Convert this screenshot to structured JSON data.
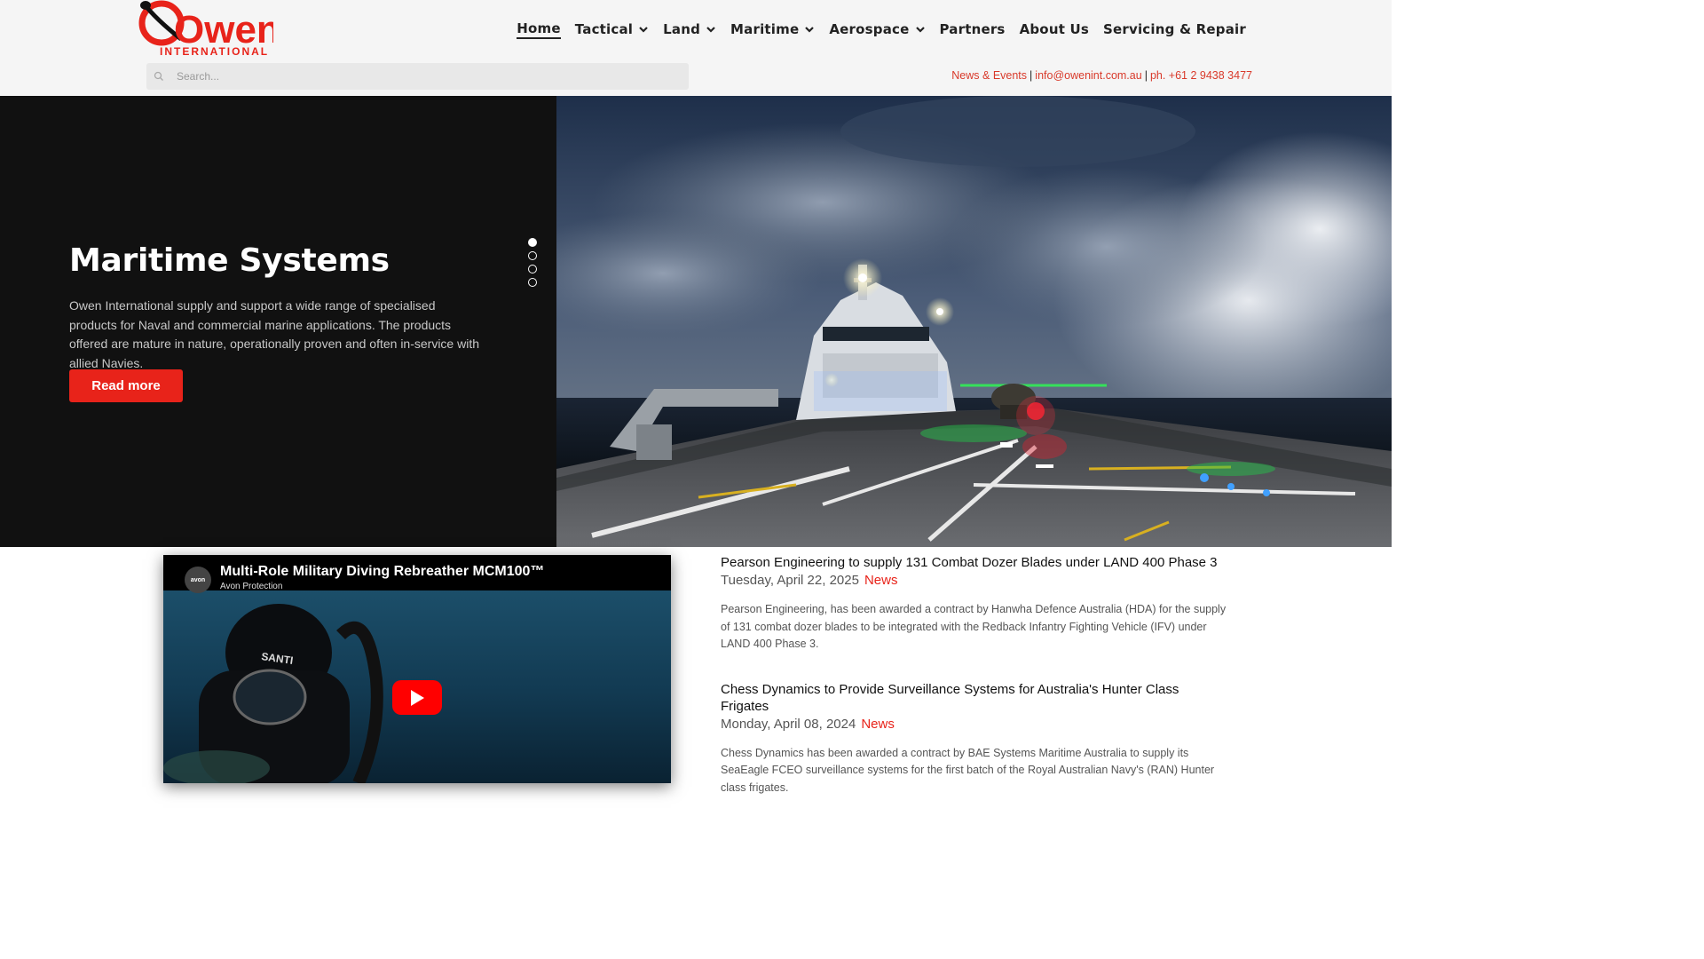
{
  "brand": {
    "logo_text": "Owen",
    "logo_subtext": "INTERNATIONAL",
    "brand_color": "#e8231a"
  },
  "nav": {
    "items": [
      {
        "label": "Home",
        "dropdown": false,
        "active": true
      },
      {
        "label": "Tactical",
        "dropdown": true
      },
      {
        "label": "Land",
        "dropdown": true
      },
      {
        "label": "Maritime",
        "dropdown": true
      },
      {
        "label": "Aerospace",
        "dropdown": true
      },
      {
        "label": "Partners",
        "dropdown": false
      },
      {
        "label": "About Us",
        "dropdown": false
      },
      {
        "label": "Servicing & Repair",
        "dropdown": false
      }
    ]
  },
  "search": {
    "placeholder": "Search...",
    "icon": "search-icon"
  },
  "contact": {
    "news_events": "News & Events",
    "email": "info@owenint.com.au",
    "phone": "ph. +61 2 9438 3477",
    "separator": "|"
  },
  "hero": {
    "title": "Maritime Systems",
    "description": "Owen International supply and support a wide range of specialised products for Naval and commercial marine applications. The products offered are mature in nature, operationally proven and often in-service with allied Navies.",
    "button_label": "Read more",
    "slides_count": 4,
    "active_slide": 1
  },
  "video": {
    "title": "Multi-Role Military Diving Rebreather MCM100™",
    "channel": "Avon Protection",
    "channel_logo_text": "avon"
  },
  "news": [
    {
      "title": "Pearson Engineering to supply 131 Combat Dozer Blades under LAND 400 Phase 3",
      "date": "Tuesday, April 22, 2025",
      "category": "News",
      "summary": "Pearson Engineering, has been awarded a contract by Hanwha Defence Australia (HDA) for the supply of 131 combat dozer blades to be integrated with the Redback Infantry Fighting Vehicle (IFV) under LAND 400 Phase 3."
    },
    {
      "title": "Chess Dynamics to Provide Surveillance Systems for Australia's Hunter Class Frigates",
      "date": "Monday, April 08, 2024",
      "category": "News",
      "summary": "Chess Dynamics has been awarded a contract by BAE Systems Maritime Australia to supply its SeaEagle FCEO surveillance systems for the first batch of the Royal Australian Navy's (RAN) Hunter class frigates."
    }
  ]
}
